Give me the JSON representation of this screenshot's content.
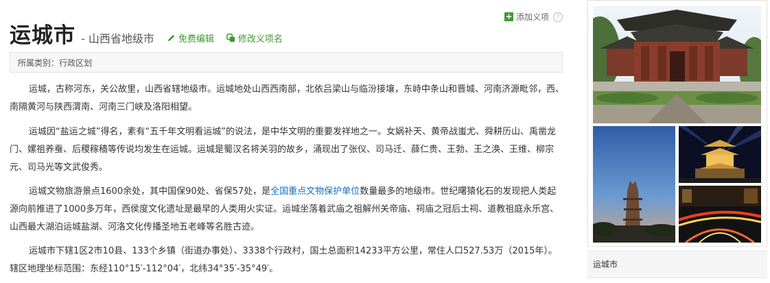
{
  "header": {
    "add_sense": "添加义项",
    "title": "运城市",
    "subtitle": "- 山西省地级市",
    "edit": "免费编辑",
    "modify": "修改义项名"
  },
  "category": {
    "text": "所属类别：行政区划"
  },
  "paragraphs": {
    "p1": "运城，古称河东，关公故里，山西省辖地级市。运城地处山西西南部，北依吕梁山与临汾接壤，东峙中条山和晋城、河南济源毗邻，西、南隔黄河与陕西渭南、河南三门峡及洛阳相望。",
    "p2": "运城因“盐运之城”得名，素有“五千年文明看运城”的说法，是中华文明的重要发祥地之一。女娲补天、黄帝战蚩尤、舜耕历山、禹凿龙门、嫘祖养蚕、后稷稼穑等传说均发生在运城。运城是蜀汉名将关羽的故乡，涌现出了张仪、司马迁、薛仁贵、王勃、王之涣、王维、柳宗元、司马光等文武俊秀。",
    "p3_before": "运城文物旅游景点1600余处，其中国保90处、省保57处，是",
    "p3_link": "全国重点文物保护单位",
    "p3_after": "数量最多的地级市。世纪曙猿化石的发现把人类起源向前推进了1000多万年，西侯度文化遗址是最早的人类用火实证。运城坐落着武庙之祖解州关帝庙、祠庙之冠后土祠、道教祖庭永乐宫、山西最大湖泊运城盐湖、河洛文化传播圣地五老峰等名胜古迹。",
    "p4": "运城市下辖1区2市10县、133个乡镇（街道办事处）、3338个行政村，国土总面积14233平方公里，常住人口527.53万（2015年）。辖区地理坐标范围：东经110°15′-112°04′，北纬34°35′-35°49′。"
  },
  "sidebar": {
    "caption": "运城市"
  },
  "colors": {
    "accent_green": "#3c9a2f",
    "link_blue": "#136ec2"
  }
}
